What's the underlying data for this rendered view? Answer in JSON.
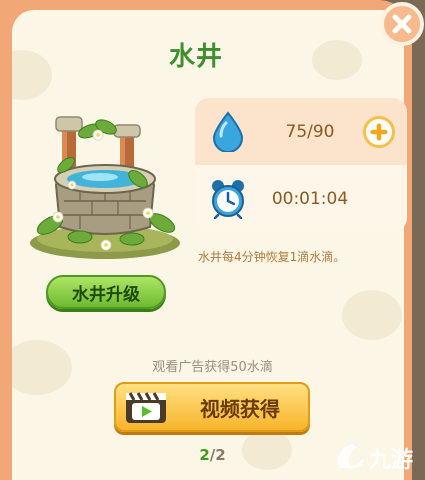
{
  "dialog": {
    "title": "水井",
    "close_icon": "close-icon"
  },
  "well": {
    "image": "stone-well-illustration",
    "upgrade_label": "水井升级"
  },
  "stats": {
    "water": {
      "icon": "water-drop-icon",
      "value": "75/90",
      "plus_icon": "plus-icon"
    },
    "timer": {
      "icon": "alarm-clock-icon",
      "value": "00:01:04"
    },
    "description": "水井每4分钟恢复1滴水滴。"
  },
  "ad": {
    "caption": "观看广告获得50水滴",
    "button_label": "视频获得",
    "button_icon": "video-clapper-icon",
    "count_current": "2",
    "count_sep": "/",
    "count_total": "2"
  },
  "watermark": {
    "text": "九游"
  },
  "colors": {
    "frame": "#f2a777",
    "paper": "#fcf6e6",
    "title_green": "#3f8f2e",
    "accent_orange": "#f7b52b"
  }
}
